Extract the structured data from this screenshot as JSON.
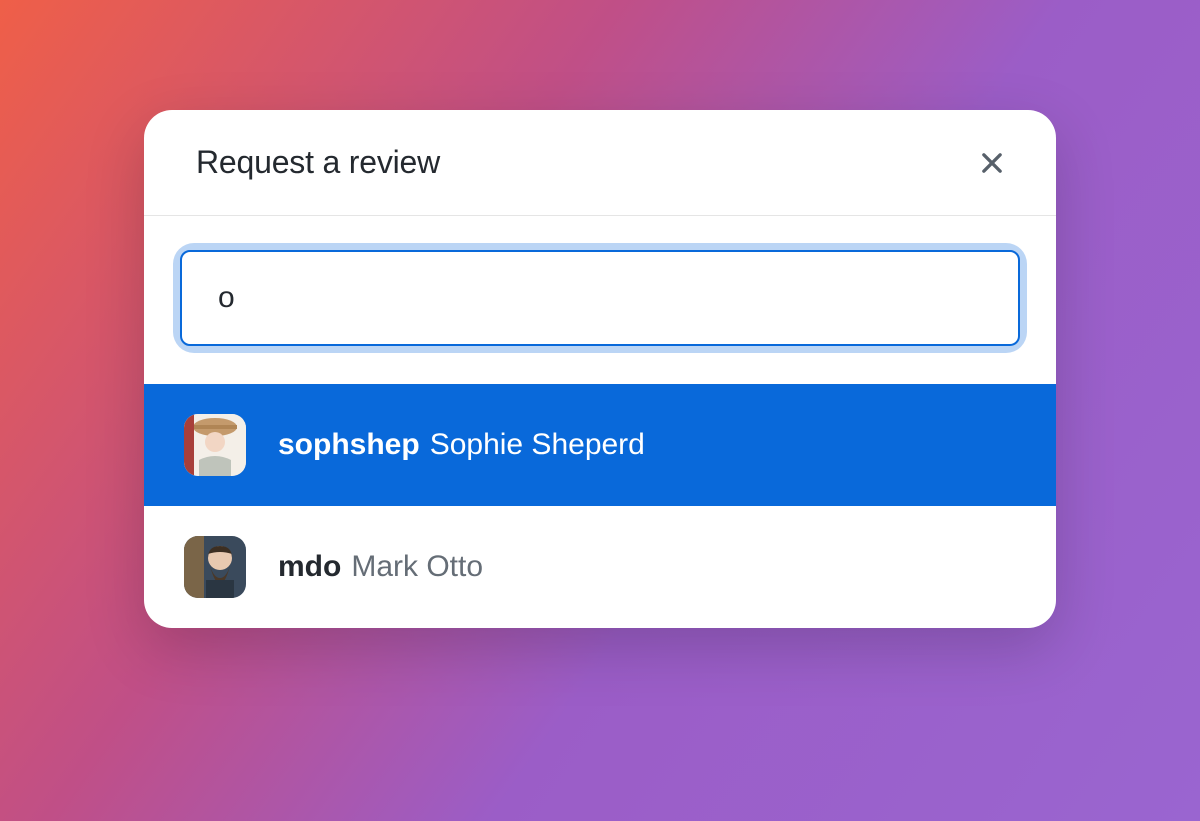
{
  "dialog": {
    "title": "Request a review",
    "search_value": "o",
    "results": [
      {
        "username": "sophshep",
        "fullname": "Sophie Sheperd",
        "selected": true
      },
      {
        "username": "mdo",
        "fullname": "Mark Otto",
        "selected": false
      }
    ]
  }
}
